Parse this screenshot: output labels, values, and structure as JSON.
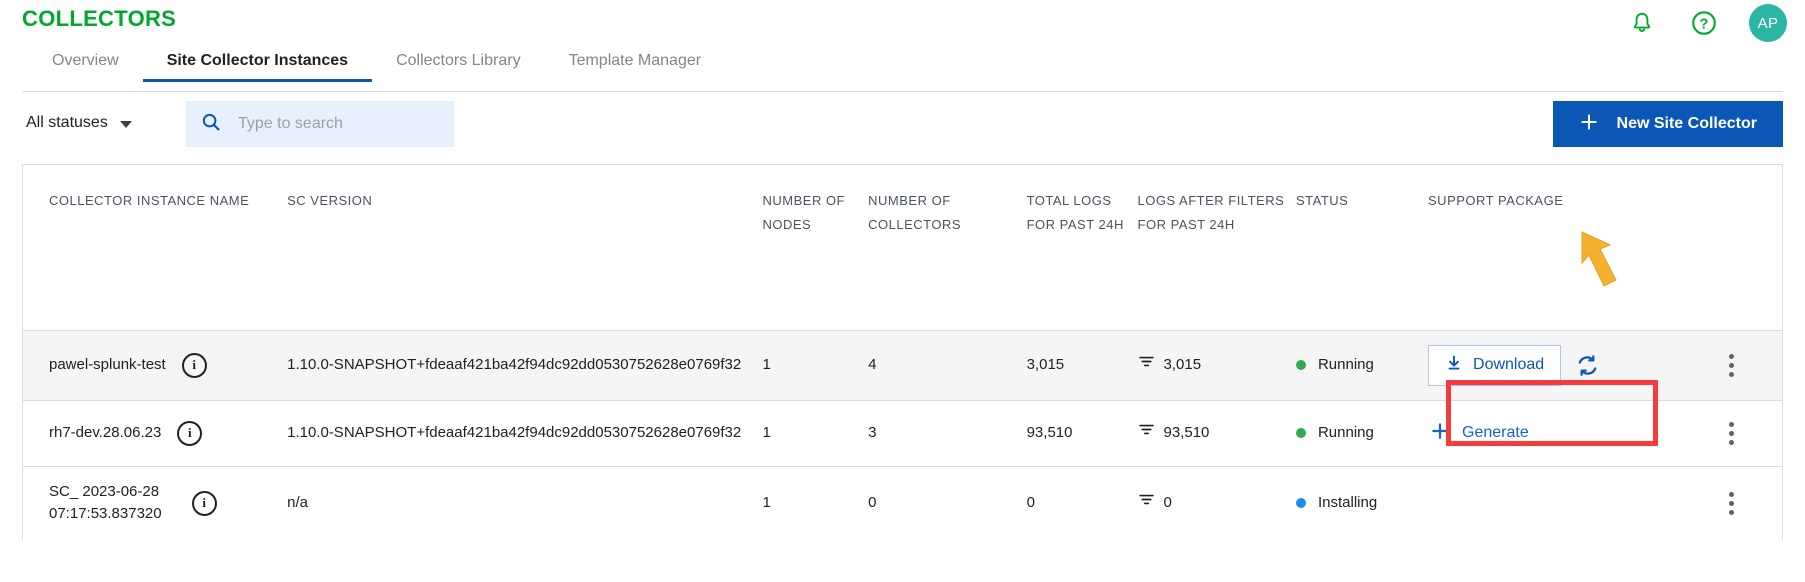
{
  "header": {
    "brand": "COLLECTORS",
    "icons": [
      {
        "name": "notifications-bell-icon",
        "label": "bell-icon"
      },
      {
        "name": "help-icon",
        "label": "question-mark-circle-icon"
      }
    ],
    "avatar_initials": "AP",
    "avatar_color": "#2bb6a3",
    "brand_color": "#00a82d"
  },
  "tabs": [
    {
      "label": "Overview",
      "active": false
    },
    {
      "label": "Site Collector Instances",
      "active": true
    },
    {
      "label": "Collectors Library",
      "active": false
    },
    {
      "label": "Template Manager",
      "active": false
    }
  ],
  "toolbar": {
    "status_filter_label": "All statuses",
    "search_placeholder": "Type to search",
    "search_value": "",
    "new_collector_label": "New Site Collector",
    "new_collector_icon": "plus-icon",
    "primary_color": "#0b57b5"
  },
  "table": {
    "headers": [
      "COLLECTOR INSTANCE NAME",
      "SC VERSION",
      "NUMBER OF NODES",
      "NUMBER OF COLLECTORS",
      "TOTAL LOGS FOR PAST 24H",
      "LOGS AFTER FILTERS FOR PAST 24H",
      "STATUS",
      "SUPPORT PACKAGE",
      ""
    ],
    "rows": [
      {
        "name": "pawel-splunk-test",
        "name_line2": "",
        "version": "1.10.0-SNAPSHOT+fdeaaf421ba42f94dc92dd0530752628e0769f32",
        "nodes": "1",
        "collectors": "4",
        "total_logs": "3,015",
        "filtered_logs": "3,015",
        "status": "Running",
        "status_color": "#34a853",
        "support_action": "Download",
        "support_action_type": "download",
        "has_refresh": true,
        "highlighted": true
      },
      {
        "name": "rh7-dev.28.06.23",
        "name_line2": "",
        "version": "1.10.0-SNAPSHOT+fdeaaf421ba42f94dc92dd0530752628e0769f32",
        "nodes": "1",
        "collectors": "3",
        "total_logs": "93,510",
        "filtered_logs": "93,510",
        "status": "Running",
        "status_color": "#34a853",
        "support_action": "Generate",
        "support_action_type": "generate",
        "has_refresh": false,
        "highlighted": false
      },
      {
        "name": "SC_ 2023-06-28",
        "name_line2": "07:17:53.837320",
        "version": "n/a",
        "nodes": "1",
        "collectors": "0",
        "total_logs": "0",
        "filtered_logs": "0",
        "status": "Installing",
        "status_color": "#1a8dea",
        "support_action": "",
        "support_action_type": "none",
        "has_refresh": false,
        "highlighted": false
      }
    ]
  },
  "annotations": {
    "highlight_color": "#f53b3b",
    "arrow_color": "#f5b02e"
  }
}
